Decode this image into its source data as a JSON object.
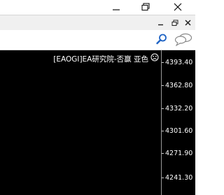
{
  "window": {
    "minimize_icon": "minimize-icon",
    "restore_icon": "restore-icon",
    "close_icon": "close-icon"
  },
  "child_window": {
    "minimize_icon": "minimize-icon",
    "restore_icon": "restore-icon",
    "close_icon": "close-icon"
  },
  "toolbar": {
    "search_icon": "search-icon",
    "chat_icon": "chat-icon"
  },
  "chart": {
    "ea_label": "[EAOGI]EA研究院-否赢 亚色",
    "ea_status_icon": "frown-icon",
    "background": "#000000",
    "price_axis": [
      "4393.40",
      "4362.80",
      "4332.20",
      "4301.60",
      "4271.90",
      "4241.30"
    ]
  }
}
